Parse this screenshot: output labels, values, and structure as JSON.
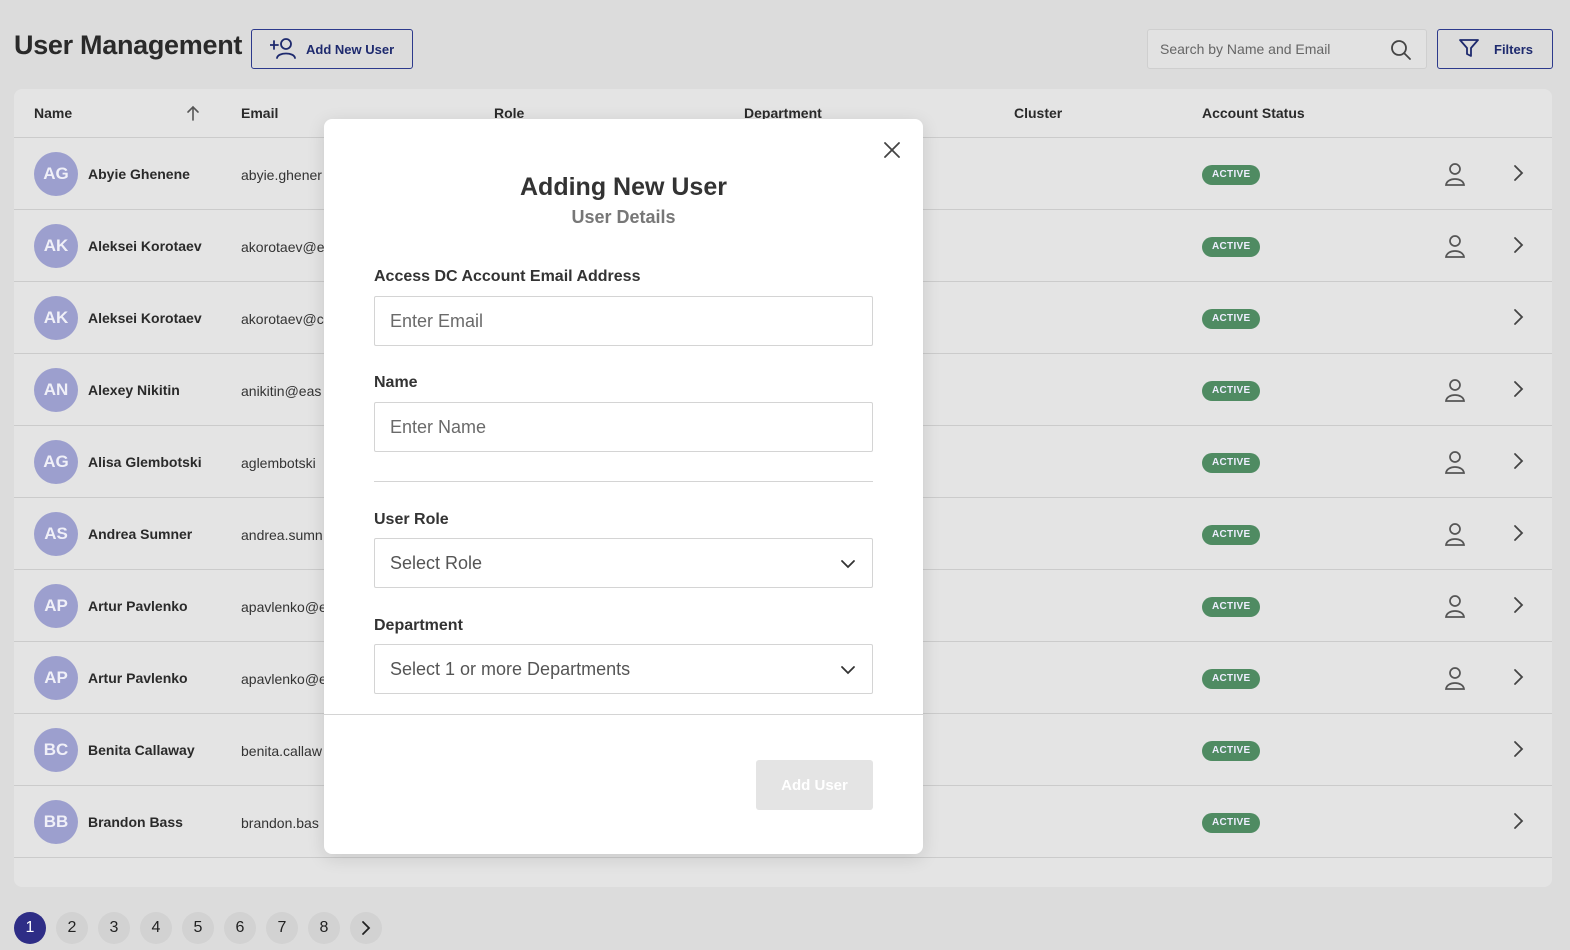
{
  "header": {
    "title": "User Management",
    "add_new_user_label": "Add New User",
    "search_placeholder": "Search by Name and Email",
    "filters_label": "Filters"
  },
  "table": {
    "columns": {
      "name": "Name",
      "email": "Email",
      "role": "Role",
      "department": "Department",
      "cluster": "Cluster",
      "account_status": "Account Status"
    },
    "rows": [
      {
        "initials": "AG",
        "name": "Abyie Ghenene",
        "email": "abyie.ghener",
        "status": "ACTIVE",
        "has_user_icon": true
      },
      {
        "initials": "AK",
        "name": "Aleksei Korotaev",
        "email": "akorotaev@e",
        "status": "ACTIVE",
        "has_user_icon": true
      },
      {
        "initials": "AK",
        "name": "Aleksei Korotaev",
        "email": "akorotaev@c",
        "status": "ACTIVE",
        "has_user_icon": false
      },
      {
        "initials": "AN",
        "name": "Alexey Nikitin",
        "email": "anikitin@eas",
        "status": "ACTIVE",
        "has_user_icon": true
      },
      {
        "initials": "AG",
        "name": "Alisa Glembotski",
        "email": "aglembotski",
        "status": "ACTIVE",
        "has_user_icon": true
      },
      {
        "initials": "AS",
        "name": "Andrea Sumner",
        "email": "andrea.sumn",
        "status": "ACTIVE",
        "has_user_icon": true
      },
      {
        "initials": "AP",
        "name": "Artur Pavlenko",
        "email": "apavlenko@e",
        "status": "ACTIVE",
        "has_user_icon": true
      },
      {
        "initials": "AP",
        "name": "Artur Pavlenko",
        "email": "apavlenko@e",
        "status": "ACTIVE",
        "has_user_icon": true
      },
      {
        "initials": "BC",
        "name": "Benita Callaway",
        "email": "benita.callaw",
        "status": "ACTIVE",
        "has_user_icon": false
      },
      {
        "initials": "BB",
        "name": "Brandon Bass",
        "email": "brandon.bas",
        "status": "ACTIVE",
        "has_user_icon": false
      }
    ]
  },
  "pagination": {
    "pages": [
      "1",
      "2",
      "3",
      "4",
      "5",
      "6",
      "7",
      "8"
    ],
    "current": "1"
  },
  "modal": {
    "title": "Adding New User",
    "subtitle": "User Details",
    "email_label": "Access DC Account Email Address",
    "email_placeholder": "Enter Email",
    "name_label": "Name",
    "name_placeholder": "Enter Name",
    "role_label": "User Role",
    "role_placeholder": "Select Role",
    "department_label": "Department",
    "department_placeholder": "Select 1 or more Departments",
    "add_user_label": "Add User"
  },
  "colors": {
    "accent": "#2e2d86",
    "status_active": "#4f8b62",
    "avatar": "#9c9fce"
  }
}
